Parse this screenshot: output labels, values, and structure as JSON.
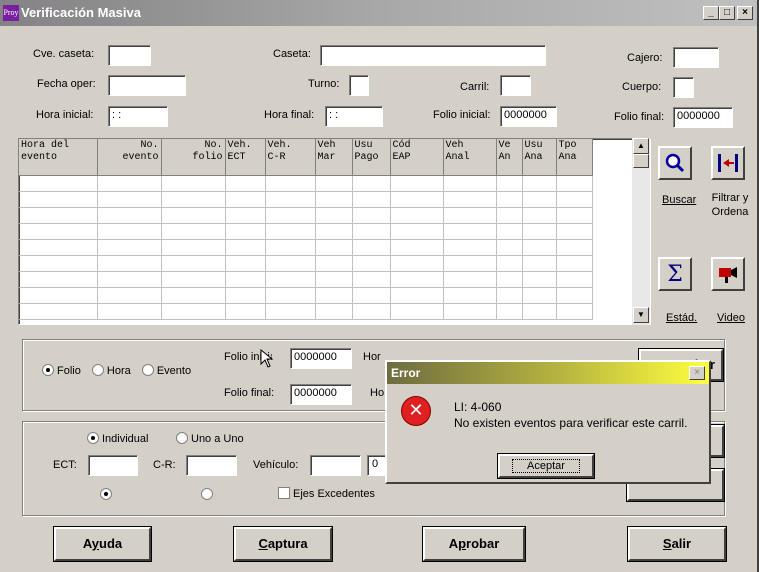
{
  "window": {
    "title": "Verificación Masiva",
    "app_icon_text": "Proy",
    "controls": [
      "_",
      "□",
      "×"
    ]
  },
  "header_fields": {
    "cve_caseta": {
      "label": "Cve. caseta:",
      "value": ""
    },
    "caseta": {
      "label": "Caseta:",
      "value": ""
    },
    "cajero": {
      "label": "Cajero:",
      "value": ""
    },
    "fecha_oper": {
      "label": "Fecha oper:",
      "value": ""
    },
    "turno": {
      "label": "Turno:",
      "value": ""
    },
    "carril": {
      "label": "Carril:",
      "value": ""
    },
    "cuerpo": {
      "label": "Cuerpo:",
      "value": ""
    },
    "hora_inicial": {
      "label": "Hora inicial:",
      "value": ": :"
    },
    "hora_final": {
      "label": "Hora final:",
      "value": ": :"
    },
    "folio_inicial": {
      "label": "Folio inicial:",
      "value": "0000000"
    },
    "folio_final": {
      "label": "Folio final:",
      "value": "0000000"
    }
  },
  "grid": {
    "columns": [
      {
        "label": "Hora del\nevento",
        "align": "left"
      },
      {
        "label": "No.\nevento",
        "align": "right"
      },
      {
        "label": "No.\nfolio",
        "align": "right"
      },
      {
        "label": "Veh.\nECT",
        "align": "left"
      },
      {
        "label": "Veh.\nC-R",
        "align": "left"
      },
      {
        "label": "Veh\nMar",
        "align": "left"
      },
      {
        "label": "Usu\nPago",
        "align": "left"
      },
      {
        "label": "Cód\nEAP",
        "align": "left"
      },
      {
        "label": "Veh\nAnal",
        "align": "left"
      },
      {
        "label": "Ve\nAn",
        "align": "left"
      },
      {
        "label": "Usu\nAna",
        "align": "left"
      },
      {
        "label": "Tpo\nAna",
        "align": "left"
      }
    ],
    "empty_rows": 9
  },
  "side_tools": {
    "buscar": {
      "icon": "magnifier-icon",
      "label": "Buscar"
    },
    "filtrar": {
      "icon": "filter-sort-icon",
      "label": "Filtrar y Ordena"
    },
    "estad": {
      "icon": "sigma-icon",
      "label": "Estád."
    },
    "video": {
      "icon": "video-camera-icon",
      "label": "Video"
    }
  },
  "filter_group": {
    "radios": [
      {
        "label": "Folio",
        "selected": true
      },
      {
        "label": "Hora",
        "selected": false
      },
      {
        "label": "Evento",
        "selected": false
      }
    ],
    "folio_inicial": {
      "label": "Folio inicial:",
      "value": "0000000"
    },
    "folio_final": {
      "label": "Folio final:",
      "value": "0000000"
    },
    "hora_label": "Hor",
    "hora_final_label": "Ho",
    "evento_value": "0000000",
    "button_partial": "har"
  },
  "vehicle_group": {
    "mode_radios": [
      {
        "label": "Individual",
        "selected": true
      },
      {
        "label": "Uno a Uno",
        "selected": false
      }
    ],
    "ect": {
      "label": "ECT:",
      "value": ""
    },
    "cr": {
      "label": "C-R:",
      "value": ""
    },
    "vehiculo": {
      "label": "Vehículo:",
      "value": "",
      "extra": "0"
    },
    "ejes": {
      "label": "Ejes Excedentes",
      "checked": false
    }
  },
  "bottom_buttons": [
    {
      "label": "Ayuda",
      "mnemonic": "y"
    },
    {
      "label": "Captura",
      "mnemonic": "C"
    },
    {
      "label": "Aprobar",
      "mnemonic": "p"
    },
    {
      "label": "Salir",
      "mnemonic": "S"
    }
  ],
  "error_dialog": {
    "title": "Error",
    "code": "LI: 4-060",
    "message": "No existen eventos para verificar este carril.",
    "ok_label": "Aceptar",
    "close_glyph": "×"
  }
}
